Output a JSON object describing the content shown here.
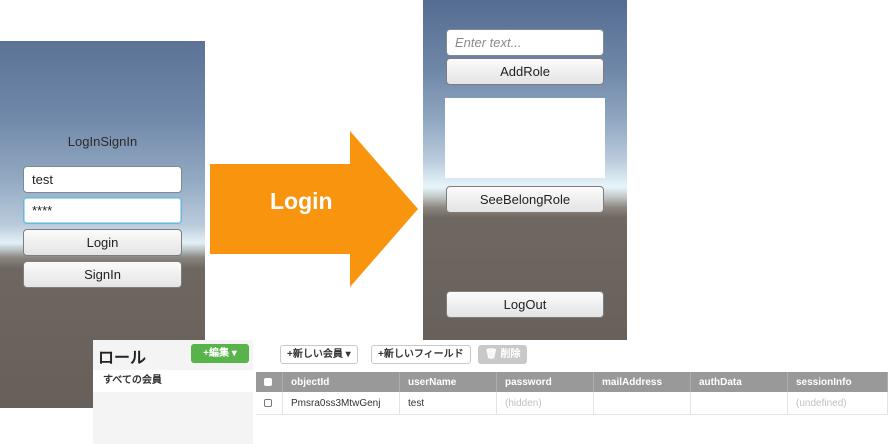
{
  "left_screen": {
    "title": "LogInSignIn",
    "username_value": "test",
    "password_value": "****",
    "login_button": "Login",
    "signin_button": "SignIn"
  },
  "arrow": {
    "label": "Login",
    "color": "#f9940e"
  },
  "right_screen": {
    "input_placeholder": "Enter text...",
    "add_role_button": "AddRole",
    "see_role_button": "SeeBelongRole",
    "logout_button": "LogOut"
  },
  "dashboard": {
    "sidebar": {
      "title": "ロール",
      "edit_button": "+編集 ▾",
      "all_members": "すべての会員"
    },
    "toolbar": {
      "new_member": "+新しい会員 ▾",
      "new_field": "+新しいフィールド",
      "delete": "🗑 削除"
    },
    "columns": [
      "objectId",
      "userName",
      "password",
      "mailAddress",
      "authData",
      "sessionInfo"
    ],
    "rows": [
      {
        "objectId": "Pmsra0ss3MtwGenj",
        "userName": "test",
        "password": "(hidden)",
        "mailAddress": "",
        "authData": "",
        "sessionInfo": "(undefined)"
      }
    ],
    "colors": {
      "accent_green": "#58b34a",
      "header_gray": "#999999"
    }
  }
}
